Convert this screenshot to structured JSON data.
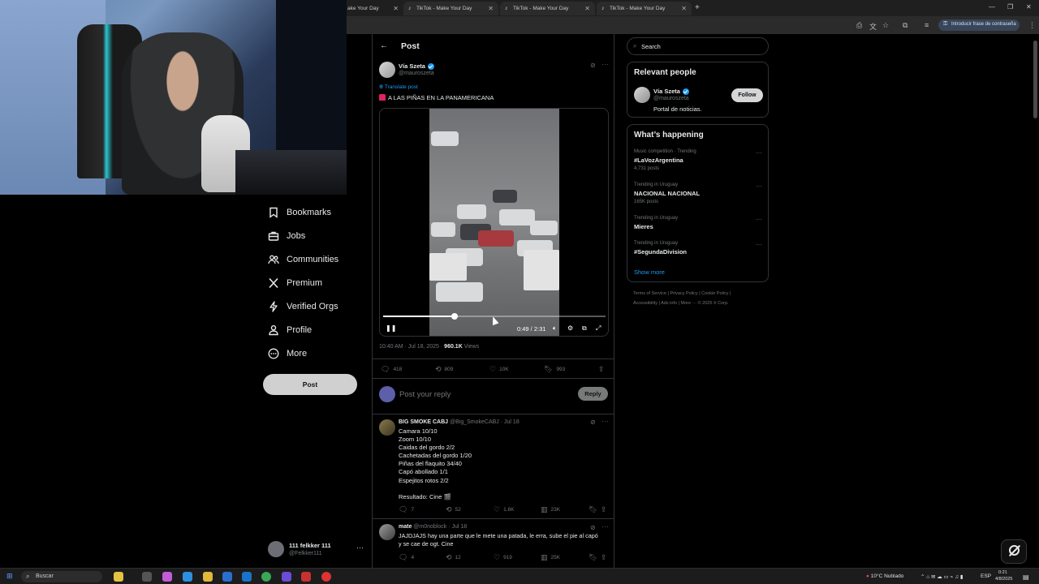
{
  "browser": {
    "tabs": [
      {
        "title": "ake Your Day"
      },
      {
        "title": "TikTok - Make Your Day"
      },
      {
        "title": "TikTok - Make Your Day"
      },
      {
        "title": "TikTok - Make Your Day"
      }
    ],
    "password_prompt": "Introducir frase de contraseña"
  },
  "sidebar": {
    "items": [
      {
        "label": "Bookmarks",
        "icon": "bookmark-icon"
      },
      {
        "label": "Jobs",
        "icon": "briefcase-icon"
      },
      {
        "label": "Communities",
        "icon": "people-icon"
      },
      {
        "label": "Premium",
        "icon": "x-logo-icon"
      },
      {
        "label": "Verified Orgs",
        "icon": "lightning-icon"
      },
      {
        "label": "Profile",
        "icon": "person-icon"
      },
      {
        "label": "More",
        "icon": "more-circle-icon"
      }
    ],
    "post_button": "Post",
    "account": {
      "name": "111 felkker 111",
      "handle": "@Felkker111"
    }
  },
  "main": {
    "header_title": "Post",
    "post": {
      "author_name": "Vía Szeta",
      "author_handle": "@mauroszeta",
      "translate": "Translate post",
      "text": "A LAS PIÑAS EN LA PANAMERICANA",
      "video": {
        "time": "0:49 / 2:31",
        "progress": 0.32
      },
      "timestamp": "10:40 AM · Jul 18, 2025 · ",
      "views_count": "960.1K",
      "views_label": " Views",
      "stats": {
        "replies": "418",
        "reposts": "809",
        "likes": "10K",
        "bookmarks": "993"
      }
    },
    "reply_placeholder": "Post your reply",
    "reply_button": "Reply",
    "comments": [
      {
        "name": "BIG SMOKE CABJ",
        "handle": "@Big_SmokeCABJ · Jul 18",
        "lines": [
          "Camara 10/10",
          "Zoom 10/10",
          "Caidas del gordo 2/2",
          "Cachetadas del gordo 1/20",
          "Piñas del flaquito 34/40",
          "Capó abollado 1/1",
          "Espejitos rotos 2/2",
          "",
          "Resultado: Cine 🎬"
        ],
        "stats": {
          "replies": "7",
          "reposts": "52",
          "likes": "1.6K",
          "views": "23K"
        }
      },
      {
        "name": "mate",
        "handle": "@m0noblock · Jul 18",
        "lines": [
          "JAJDJAJS hay una parte que le mete una patada, le erra, sube el pie al capó",
          "y se cae de ogt. Cine"
        ],
        "stats": {
          "replies": "4",
          "reposts": "12",
          "likes": "919",
          "views": "25K"
        }
      }
    ]
  },
  "right": {
    "search_placeholder": "Search",
    "relevant_title": "Relevant people",
    "person": {
      "name": "Vía Szeta",
      "handle": "@mauroszeta",
      "bio": "Portal de noticias.",
      "follow": "Follow"
    },
    "happening_title": "What’s happening",
    "trends": [
      {
        "context": "Music competition · Trending",
        "name": "#LaVozArgentina",
        "count": "4,731 posts"
      },
      {
        "context": "Trending in Uruguay",
        "name": "NACIONAL NACIONAL",
        "count": "165K posts"
      },
      {
        "context": "Trending in Uruguay",
        "name": "Mieres",
        "count": ""
      },
      {
        "context": "Trending in Uruguay",
        "name": "#SegundaDivision",
        "count": ""
      }
    ],
    "show_more": "Show more",
    "footer": {
      "row1": "Terms of Service  |  Privacy Policy  |  Cookie Policy  |",
      "row2": "Accessibility  |  Ads info  |  More ···  © 2025 X Corp."
    }
  },
  "taskbar": {
    "search": "Buscar",
    "weather": "10°C  Nublado",
    "lang": "ESP",
    "time": "0:21",
    "date": "4/8/2025"
  },
  "colors": {
    "accent": "#1d9bf0",
    "background": "#000000",
    "border": "#2f3336",
    "muted": "#71767b"
  }
}
